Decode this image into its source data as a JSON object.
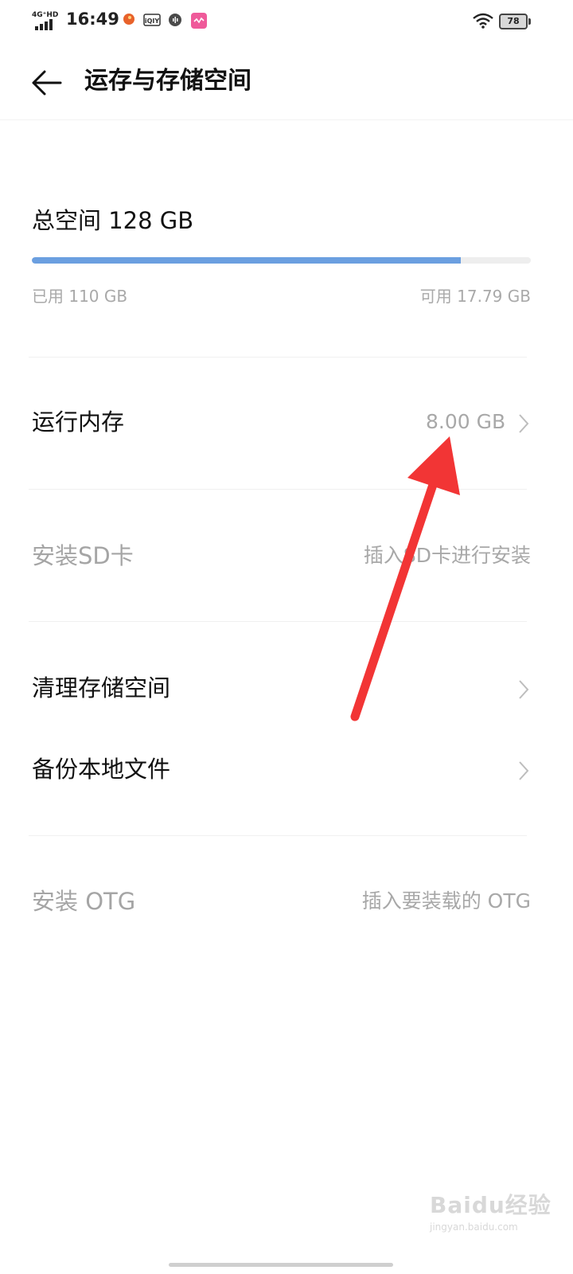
{
  "status_bar": {
    "network": "4G⁺HD",
    "time": "16:49",
    "battery": "78",
    "apps": [
      "orange-app-icon",
      "iqiyi-app-icon",
      "voice-app-icon",
      "pink-app-icon"
    ]
  },
  "header": {
    "title": "运存与存储空间"
  },
  "storage": {
    "total_label": "总空间 128 GB",
    "used_label": "已用 110 GB",
    "available_label": "可用 17.79 GB",
    "used_fraction": 0.86,
    "bar_color": "#6b9fe0"
  },
  "items": {
    "ram": {
      "label": "运行内存",
      "value": "8.00 GB"
    },
    "sd_card": {
      "label": "安装SD卡",
      "value": "插入SD卡进行安装"
    },
    "clean": {
      "label": "清理存储空间"
    },
    "backup": {
      "label": "备份本地文件"
    },
    "otg": {
      "label": "安装 OTG",
      "value": "插入要装载的 OTG"
    }
  },
  "annotation": {
    "color": "#f23535"
  },
  "watermark": {
    "text": "Baidu经验",
    "sub": "jingyan.baidu.com"
  }
}
